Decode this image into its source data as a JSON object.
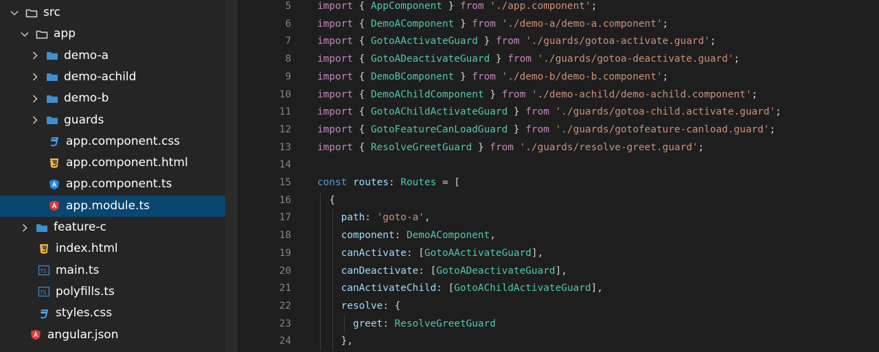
{
  "explorer": {
    "items": [
      {
        "label": "src",
        "type": "root-folder",
        "indent": 0,
        "expanded": true,
        "icon": "folder-outline-icon"
      },
      {
        "label": "app",
        "type": "root-folder",
        "indent": 1,
        "expanded": true,
        "icon": "folder-outline-icon"
      },
      {
        "label": "demo-a",
        "type": "folder",
        "indent": 2,
        "expanded": false,
        "icon": "folder-icon"
      },
      {
        "label": "demo-achild",
        "type": "folder",
        "indent": 2,
        "expanded": false,
        "icon": "folder-icon"
      },
      {
        "label": "demo-b",
        "type": "folder",
        "indent": 2,
        "expanded": false,
        "icon": "folder-icon"
      },
      {
        "label": "guards",
        "type": "folder",
        "indent": 2,
        "expanded": false,
        "icon": "folder-icon"
      },
      {
        "label": "app.component.css",
        "type": "file",
        "indent": 2,
        "icon": "css-file-icon"
      },
      {
        "label": "app.component.html",
        "type": "file",
        "indent": 2,
        "icon": "html-file-icon"
      },
      {
        "label": "app.component.ts",
        "type": "file",
        "indent": 2,
        "icon": "angular-component-icon"
      },
      {
        "label": "app.module.ts",
        "type": "file",
        "indent": 2,
        "icon": "angular-module-icon",
        "selected": true
      },
      {
        "label": "feature-c",
        "type": "folder",
        "indent": 1,
        "expanded": false,
        "icon": "folder-icon"
      },
      {
        "label": "index.html",
        "type": "file",
        "indent": 1,
        "icon": "html-file-icon"
      },
      {
        "label": "main.ts",
        "type": "file",
        "indent": 1,
        "icon": "typescript-file-icon"
      },
      {
        "label": "polyfills.ts",
        "type": "file",
        "indent": 1,
        "icon": "typescript-file-icon"
      },
      {
        "label": "styles.css",
        "type": "file",
        "indent": 1,
        "icon": "css-file-icon"
      },
      {
        "label": "angular.json",
        "type": "file",
        "indent": 0,
        "icon": "angular-json-icon"
      }
    ]
  },
  "editor": {
    "lines": [
      {
        "n": "5",
        "tokens": [
          [
            "kw2",
            "import"
          ],
          [
            "fn",
            " { "
          ],
          [
            "cls",
            "AppComponent"
          ],
          [
            "fn",
            " } "
          ],
          [
            "kw2",
            "from"
          ],
          [
            "fn",
            " "
          ],
          [
            "str",
            "'./app.component'"
          ],
          [
            "fn",
            ";"
          ]
        ]
      },
      {
        "n": "6",
        "tokens": [
          [
            "kw2",
            "import"
          ],
          [
            "fn",
            " { "
          ],
          [
            "cls",
            "DemoAComponent"
          ],
          [
            "fn",
            " } "
          ],
          [
            "kw2",
            "from"
          ],
          [
            "fn",
            " "
          ],
          [
            "str",
            "'./demo-a/demo-a.component'"
          ],
          [
            "fn",
            ";"
          ]
        ]
      },
      {
        "n": "7",
        "tokens": [
          [
            "kw2",
            "import"
          ],
          [
            "fn",
            " { "
          ],
          [
            "cls",
            "GotoAActivateGuard"
          ],
          [
            "fn",
            " } "
          ],
          [
            "kw2",
            "from"
          ],
          [
            "fn",
            " "
          ],
          [
            "str",
            "'./guards/gotoa-activate.guard'"
          ],
          [
            "fn",
            ";"
          ]
        ]
      },
      {
        "n": "8",
        "tokens": [
          [
            "kw2",
            "import"
          ],
          [
            "fn",
            " { "
          ],
          [
            "cls",
            "GotoADeactivateGuard"
          ],
          [
            "fn",
            " } "
          ],
          [
            "kw2",
            "from"
          ],
          [
            "fn",
            " "
          ],
          [
            "str",
            "'./guards/gotoa-deactivate.guard'"
          ],
          [
            "fn",
            ";"
          ]
        ]
      },
      {
        "n": "9",
        "tokens": [
          [
            "kw2",
            "import"
          ],
          [
            "fn",
            " { "
          ],
          [
            "cls",
            "DemoBComponent"
          ],
          [
            "fn",
            " } "
          ],
          [
            "kw2",
            "from"
          ],
          [
            "fn",
            " "
          ],
          [
            "str",
            "'./demo-b/demo-b.component'"
          ],
          [
            "fn",
            ";"
          ]
        ]
      },
      {
        "n": "10",
        "tokens": [
          [
            "kw2",
            "import"
          ],
          [
            "fn",
            " { "
          ],
          [
            "cls",
            "DemoAChildComponent"
          ],
          [
            "fn",
            " } "
          ],
          [
            "kw2",
            "from"
          ],
          [
            "fn",
            " "
          ],
          [
            "str",
            "'./demo-achild/demo-achild.component'"
          ],
          [
            "fn",
            ";"
          ]
        ]
      },
      {
        "n": "11",
        "tokens": [
          [
            "kw2",
            "import"
          ],
          [
            "fn",
            " { "
          ],
          [
            "cls",
            "GotoAChildActivateGuard"
          ],
          [
            "fn",
            " } "
          ],
          [
            "kw2",
            "from"
          ],
          [
            "fn",
            " "
          ],
          [
            "str",
            "'./guards/gotoa-child.activate.guard'"
          ],
          [
            "fn",
            ";"
          ]
        ]
      },
      {
        "n": "12",
        "tokens": [
          [
            "kw2",
            "import"
          ],
          [
            "fn",
            " { "
          ],
          [
            "cls",
            "GotoFeatureCanLoadGuard"
          ],
          [
            "fn",
            " } "
          ],
          [
            "kw2",
            "from"
          ],
          [
            "fn",
            " "
          ],
          [
            "str",
            "'./guards/gotofeature-canload.guard'"
          ],
          [
            "fn",
            ";"
          ]
        ]
      },
      {
        "n": "13",
        "tokens": [
          [
            "kw2",
            "import"
          ],
          [
            "fn",
            " { "
          ],
          [
            "cls",
            "ResolveGreetGuard"
          ],
          [
            "fn",
            " } "
          ],
          [
            "kw2",
            "from"
          ],
          [
            "fn",
            " "
          ],
          [
            "str",
            "'./guards/resolve-greet.guard'"
          ],
          [
            "fn",
            ";"
          ]
        ]
      },
      {
        "n": "14",
        "tokens": []
      },
      {
        "n": "15",
        "tokens": [
          [
            "kw",
            "const"
          ],
          [
            "fn",
            " "
          ],
          [
            "prop",
            "routes"
          ],
          [
            "fn",
            ": "
          ],
          [
            "cls",
            "Routes"
          ],
          [
            "fn",
            " = ["
          ]
        ]
      },
      {
        "n": "16",
        "tokens": [
          [
            "fn",
            "  {"
          ]
        ]
      },
      {
        "n": "17",
        "tokens": [
          [
            "prop",
            "    path"
          ],
          [
            "fn",
            ": "
          ],
          [
            "str",
            "'goto-a'"
          ],
          [
            "fn",
            ","
          ]
        ]
      },
      {
        "n": "18",
        "tokens": [
          [
            "prop",
            "    component"
          ],
          [
            "fn",
            ": "
          ],
          [
            "cls",
            "DemoAComponent"
          ],
          [
            "fn",
            ","
          ]
        ]
      },
      {
        "n": "19",
        "tokens": [
          [
            "prop",
            "    canActivate"
          ],
          [
            "fn",
            ": ["
          ],
          [
            "cls",
            "GotoAActivateGuard"
          ],
          [
            "fn",
            "],"
          ]
        ]
      },
      {
        "n": "20",
        "tokens": [
          [
            "prop",
            "    canDeactivate"
          ],
          [
            "fn",
            ": ["
          ],
          [
            "cls",
            "GotoADeactivateGuard"
          ],
          [
            "fn",
            "],"
          ]
        ]
      },
      {
        "n": "21",
        "tokens": [
          [
            "prop",
            "    canActivateChild"
          ],
          [
            "fn",
            ": ["
          ],
          [
            "cls",
            "GotoAChildActivateGuard"
          ],
          [
            "fn",
            "],"
          ]
        ]
      },
      {
        "n": "22",
        "tokens": [
          [
            "prop",
            "    resolve"
          ],
          [
            "fn",
            ": {"
          ]
        ]
      },
      {
        "n": "23",
        "tokens": [
          [
            "prop",
            "      greet"
          ],
          [
            "fn",
            ": "
          ],
          [
            "cls",
            "ResolveGreetGuard"
          ]
        ]
      },
      {
        "n": "24",
        "tokens": [
          [
            "fn",
            "    },"
          ]
        ]
      }
    ]
  },
  "colors": {
    "sidebar_bg": "#252526",
    "selection": "#094771",
    "editor_bg": "#1e1e1e",
    "keyword": "#569cd6",
    "import_keyword": "#c586c0",
    "string": "#ce9178",
    "type": "#4ec9b0",
    "property": "#9cdcfe",
    "folder": "#90a4ae",
    "folder_blue": "#3d8fd6",
    "css": "#42a5f5",
    "html": "#f4b942",
    "angular": "#e53935",
    "angular_component": "#1e88e5",
    "typescript": "#3d8fd6"
  }
}
